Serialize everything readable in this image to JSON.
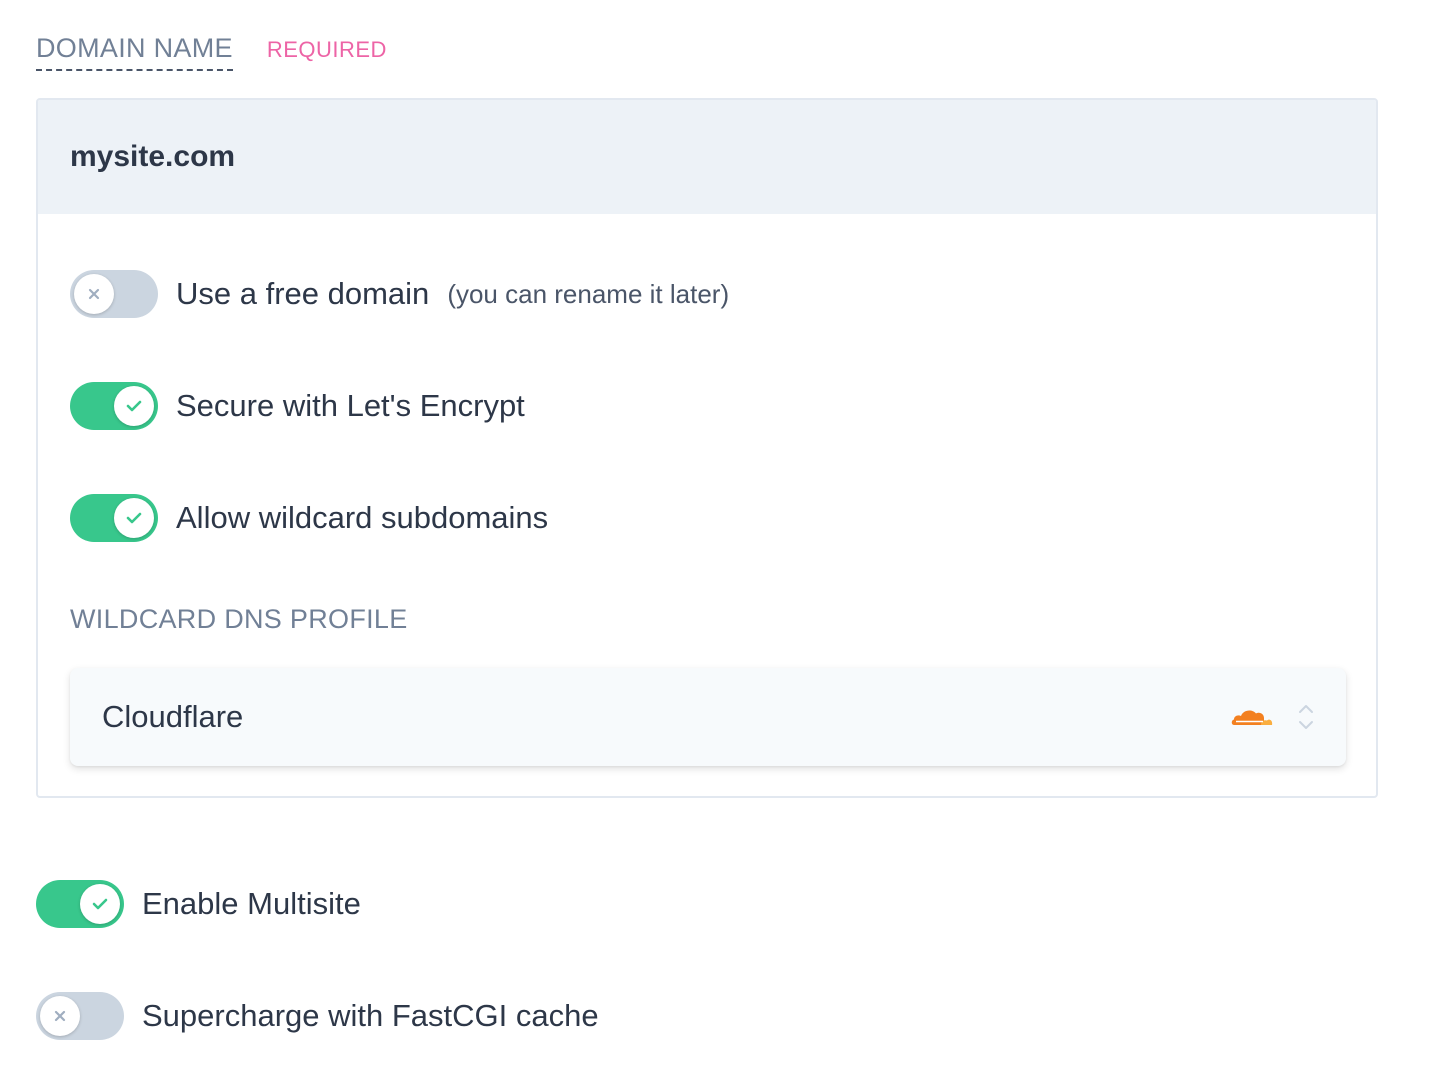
{
  "domain_field": {
    "label": "DOMAIN NAME",
    "required_badge": "REQUIRED",
    "value": "mysite.com"
  },
  "options": {
    "free_domain": {
      "label": "Use a free domain",
      "hint": "(you can rename it later)",
      "enabled": false
    },
    "lets_encrypt": {
      "label": "Secure with Let's Encrypt",
      "enabled": true
    },
    "wildcard_subdomains": {
      "label": "Allow wildcard subdomains",
      "enabled": true
    }
  },
  "wildcard_dns": {
    "label": "WILDCARD DNS PROFILE",
    "selected": "Cloudflare",
    "selected_icon": "cloudflare-cloud-icon"
  },
  "site_options": {
    "multisite": {
      "label": "Enable Multisite",
      "enabled": true
    },
    "fastcgi_cache": {
      "label": "Supercharge with FastCGI cache",
      "enabled": false
    }
  },
  "colors": {
    "toggle_on": "#38c78c",
    "toggle_off": "#cbd5e0",
    "required": "#ed64a6",
    "cloudflare_orange": "#f38020"
  }
}
